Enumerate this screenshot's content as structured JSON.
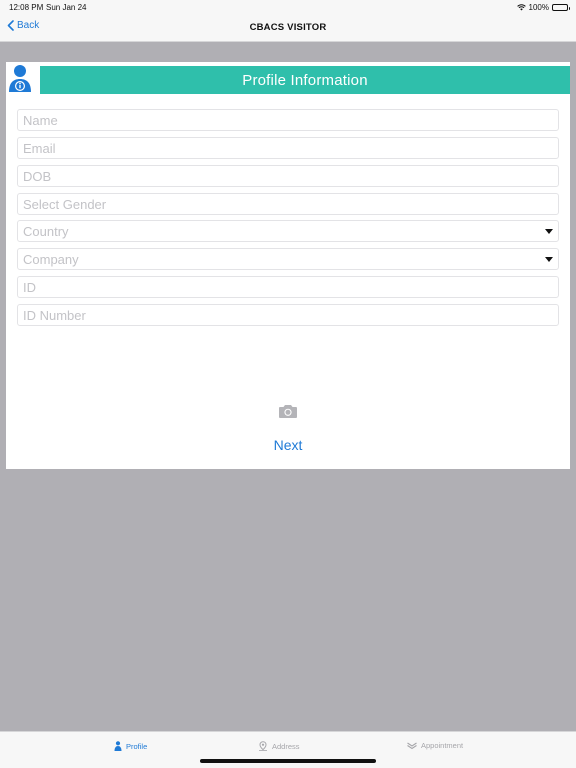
{
  "status_bar": {
    "time": "12:08 PM",
    "date": "Sun Jan 24",
    "battery": "100%",
    "icons": [
      "wifi-icon",
      "battery-icon"
    ]
  },
  "nav": {
    "back_label": "Back",
    "title": "CBACS VISITOR"
  },
  "card": {
    "title": "Profile Information",
    "header_color": "#2fbfab",
    "fields": {
      "name": {
        "placeholder": "Name",
        "value": ""
      },
      "email": {
        "placeholder": "Email",
        "value": ""
      },
      "dob": {
        "placeholder": "DOB",
        "value": ""
      },
      "gender": {
        "placeholder": "Select Gender",
        "value": ""
      },
      "country": {
        "placeholder": "Country",
        "value": ""
      },
      "company": {
        "placeholder": "Company",
        "value": ""
      },
      "id": {
        "placeholder": "ID",
        "value": ""
      },
      "id_number": {
        "placeholder": "ID Number",
        "value": ""
      }
    },
    "next_label": "Next",
    "accent_color": "#1f7ad6"
  },
  "tabs": [
    {
      "label": "Profile",
      "icon": "profile-icon",
      "active": true
    },
    {
      "label": "Address",
      "icon": "address-icon",
      "active": false
    },
    {
      "label": "Appointment",
      "icon": "appointment-icon",
      "active": false
    }
  ]
}
